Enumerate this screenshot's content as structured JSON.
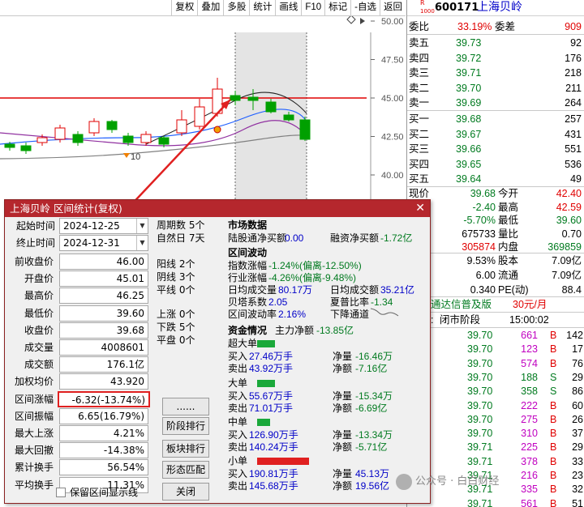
{
  "toolbar": {
    "items": [
      "复权",
      "叠加",
      "多股",
      "统计",
      "画线",
      "F10",
      "标记",
      "-自选",
      "返回"
    ]
  },
  "chart": {
    "y_ticks": [
      "50.00",
      "47.50",
      "45.00",
      "42.50",
      "40.00",
      "37.50",
      "35.00"
    ],
    "marker_label": "10",
    "colors": {
      "up": "#e00000",
      "down": "#00a000",
      "ma_blue": "#2060ff",
      "ma_purple": "#9030a0",
      "ma_gray": "#808080"
    }
  },
  "quote": {
    "badge_top": "R",
    "badge_bottom": "1000",
    "code": "600171",
    "name": "上海贝岭",
    "weibi_label": "委比",
    "weibi": "33.19%",
    "weicha_label": "委差",
    "weicha": "909",
    "asks": [
      {
        "label": "卖五",
        "price": "39.73",
        "vol": "92"
      },
      {
        "label": "卖四",
        "price": "39.72",
        "vol": "176"
      },
      {
        "label": "卖三",
        "price": "39.71",
        "vol": "218"
      },
      {
        "label": "卖二",
        "price": "39.70",
        "vol": "211"
      },
      {
        "label": "卖一",
        "price": "39.69",
        "vol": "264"
      }
    ],
    "bids": [
      {
        "label": "买一",
        "price": "39.68",
        "vol": "257"
      },
      {
        "label": "买二",
        "price": "39.67",
        "vol": "431"
      },
      {
        "label": "买三",
        "price": "39.66",
        "vol": "551"
      },
      {
        "label": "买四",
        "price": "39.65",
        "vol": "536"
      },
      {
        "label": "买五",
        "price": "39.64",
        "vol": "49"
      }
    ],
    "stats": [
      {
        "l1": "现价",
        "v1": "39.68",
        "l2": "今开",
        "v2": "42.40"
      },
      {
        "l1": "涨跌",
        "v1": "-2.40",
        "l2": "最高",
        "v2": "42.59"
      },
      {
        "l1": "涨幅",
        "v1": "-5.70%",
        "l2": "最低",
        "v2": "39.60"
      },
      {
        "l1": "总量",
        "v1": "675733",
        "l2": "量比",
        "v2": "0.70"
      },
      {
        "l1": "外盘",
        "v1": "305874",
        "l2": "内盘",
        "v2": "369859"
      }
    ],
    "more": [
      {
        "v1": "9.53%",
        "l2": "股本",
        "v2": "7.09亿"
      },
      {
        "v1": "6.00",
        "l2": "流通",
        "v2": "7.09亿"
      },
      {
        "l1": "(三)",
        "v1": "0.340",
        "l2": "PE(动)",
        "v2": "88.4"
      }
    ],
    "promo": "续费通达信普及版",
    "promo_price": "30元/月",
    "status_label": "状态:",
    "status": "闭市阶段",
    "time": "15:00:02",
    "ticks": [
      {
        "p": "39.70",
        "v": "661",
        "f": "B",
        "n": "142"
      },
      {
        "p": "39.70",
        "v": "123",
        "f": "B",
        "n": "17"
      },
      {
        "p": "39.70",
        "v": "574",
        "f": "B",
        "n": "76"
      },
      {
        "p": "39.70",
        "v": "188",
        "f": "S",
        "n": "29"
      },
      {
        "p": "39.70",
        "v": "358",
        "f": "S",
        "n": "86"
      },
      {
        "p": "39.70",
        "v": "222",
        "f": "B",
        "n": "60"
      },
      {
        "p": "39.70",
        "v": "275",
        "f": "B",
        "n": "26"
      },
      {
        "p": "39.70",
        "v": "310",
        "f": "B",
        "n": "37"
      },
      {
        "p": "39.71",
        "v": "225",
        "f": "B",
        "n": "29"
      },
      {
        "p": "39.71",
        "v": "378",
        "f": "B",
        "n": "33"
      },
      {
        "p": "39.71",
        "v": "216",
        "f": "B",
        "n": "23"
      },
      {
        "p": "39.71",
        "v": "335",
        "f": "B",
        "n": "32"
      },
      {
        "p": "39.71",
        "v": "561",
        "f": "B",
        "n": "51"
      }
    ],
    "watermark": "公众号 · 白白财经"
  },
  "dialog": {
    "title": "上海贝岭 区间统计(复权)",
    "start_label": "起始时间",
    "start": "2024-12-25",
    "end_label": "终止时间",
    "end": "2024-12-31",
    "rows": [
      {
        "label": "前收盘价",
        "value": "46.00"
      },
      {
        "label": "开盘价",
        "value": "45.01"
      },
      {
        "label": "最高价",
        "value": "46.25"
      },
      {
        "label": "最低价",
        "value": "39.60"
      },
      {
        "label": "收盘价",
        "value": "39.68"
      },
      {
        "label": "成交量",
        "value": "4008601"
      },
      {
        "label": "成交额",
        "value": "176.1亿"
      },
      {
        "label": "加权均价",
        "value": "43.920"
      },
      {
        "label": "区间涨幅",
        "value": "-6.32(-13.74%)"
      },
      {
        "label": "区间振幅",
        "value": "6.65(16.79%)"
      },
      {
        "label": "最大上涨",
        "value": "4.21%"
      },
      {
        "label": "最大回撤",
        "value": "-14.38%"
      },
      {
        "label": "累计换手",
        "value": "56.54%"
      },
      {
        "label": "平均换手",
        "value": "11.31%"
      }
    ],
    "keep_label": "保留区间显示线",
    "period": [
      "周期数 5个",
      "自然日 7天"
    ],
    "counts1": [
      "阳线 2个",
      "阴线 3个",
      "平线 0个"
    ],
    "counts2": [
      "上涨 0个",
      "下跌 5个",
      "平盘 0个"
    ],
    "buttons": [
      "......",
      "阶段排行",
      "板块排行",
      "形态匹配",
      "关闭"
    ],
    "market": {
      "title": "市场数据",
      "lgt_label": "陆股通净买额",
      "lgt": "0.00",
      "rz_label": "融资净买额",
      "rz": "-1.72亿"
    },
    "fluct": {
      "title": "区间波动",
      "idx_label": "指数涨幅",
      "idx": "-1.24%(偏离-12.50%)",
      "ind_label": "行业涨幅",
      "ind": "-4.26%(偏离-9.48%)",
      "avgvol_label": "日均成交量",
      "avgvol": "80.17万",
      "avgamt_label": "日均成交额",
      "avgamt": "35.21亿",
      "beta_label": "贝塔系数",
      "beta": "2.05",
      "sharpe_label": "夏普比率",
      "sharpe": "-1.34",
      "vol_label": "区间波动率",
      "vol": "2.16%",
      "channel": "下降通道"
    },
    "funds": {
      "title": "资金情况",
      "main_label": "主力净额",
      "main": "-13.85亿",
      "groups": [
        {
          "name": "超大单",
          "buy": "27.46万手",
          "sell": "43.92万手",
          "net": "-16.46万",
          "net2": "-7.16亿"
        },
        {
          "name": "大单",
          "buy": "55.67万手",
          "sell": "71.01万手",
          "net": "-15.34万",
          "net2": "-6.69亿"
        },
        {
          "name": "中单",
          "buy": "126.90万手",
          "sell": "140.24万手",
          "net": "-13.34万",
          "net2": "-5.71亿"
        },
        {
          "name": "小单",
          "buy": "190.81万手",
          "sell": "145.68万手",
          "net": "45.13万",
          "net2": "19.56亿"
        }
      ],
      "buy_label": "买入",
      "sell_label": "卖出",
      "net_label": "净量",
      "net2_label": "净额"
    }
  }
}
